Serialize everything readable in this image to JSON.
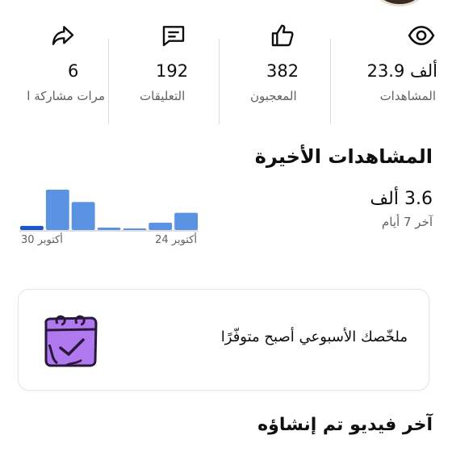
{
  "stats": [
    {
      "icon": "eye-icon",
      "value": "23.9 ألف",
      "label": "المشاهدات"
    },
    {
      "icon": "thumbs-up-icon",
      "value": "382",
      "label": "المعجبون"
    },
    {
      "icon": "comment-icon",
      "value": "192",
      "label": "التعليقات"
    },
    {
      "icon": "share-icon",
      "value": "6",
      "label": "مرات مشاركة ا"
    }
  ],
  "recent_views": {
    "title": "المشاهدات الأخيرة",
    "value": "3.6 ألف",
    "period": "آخر 7 أيام"
  },
  "chart_data": {
    "type": "bar",
    "values": [
      5,
      49,
      34,
      3,
      1,
      9,
      21
    ],
    "tick_labels": [
      "30 أكتوبر",
      "24 أكتوبر"
    ],
    "colors": [
      "#1a56c9",
      "#5a93e2",
      "#5a93e2",
      "#5a93e2",
      "#5a93e2",
      "#5a93e2",
      "#5a93e2"
    ]
  },
  "weekly_summary": {
    "text": "ملخّصك الأسبوعي أصبح متوفّرًا",
    "icon": "calendar-check-icon"
  },
  "latest_video": {
    "title": "آخر فيديو تم إنشاؤه"
  }
}
